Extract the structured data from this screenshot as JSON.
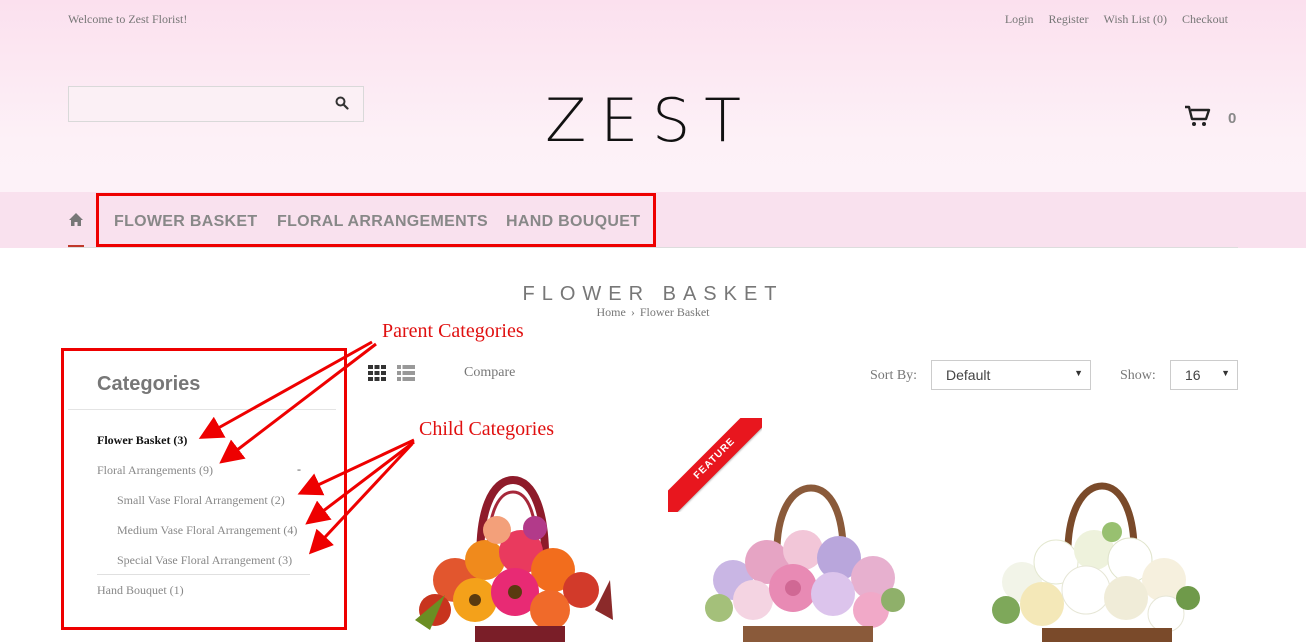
{
  "topbar": {
    "welcome": "Welcome to Zest Florist!",
    "links": [
      "Login",
      "Register",
      "Wish List (0)",
      "Checkout"
    ]
  },
  "search": {
    "placeholder": "",
    "value": "",
    "icon": "search-icon"
  },
  "logo": "ZEST",
  "cart": {
    "icon": "cart-icon",
    "count": "0"
  },
  "nav": {
    "home_icon": "home-icon",
    "items": [
      "FLOWER BASKET",
      "FLORAL ARRANGEMENTS",
      "HAND BOUQUET"
    ]
  },
  "page": {
    "title": "FLOWER BASKET",
    "breadcrumb": [
      "Home",
      "Flower Basket"
    ],
    "breadcrumb_separator": "›"
  },
  "annotations": {
    "parent": "Parent Categories",
    "child": "Child Categories",
    "color": "#ee0000"
  },
  "sidebar": {
    "title": "Categories",
    "items": [
      "Flower Basket (3)",
      "Floral Arrangements (9)",
      "Small Vase Floral Arrangement (2)",
      "Medium Vase Floral Arrangement (4)",
      "Special Vase Floral Arrangement (3)",
      "Hand Bouquet (1)"
    ],
    "toggle": "-"
  },
  "toolbar": {
    "compare": "Compare",
    "sort_label": "Sort By:",
    "sort_value": "Default",
    "show_label": "Show:",
    "show_value": "16"
  },
  "products": [
    {
      "badge": ""
    },
    {
      "badge": "FEATURE"
    },
    {
      "badge": ""
    }
  ],
  "colors": {
    "accent": "#c0392b",
    "header_bg": "#fbe0ee",
    "nav_bg": "#f9e1ee",
    "ribbon": "#e8161e"
  }
}
